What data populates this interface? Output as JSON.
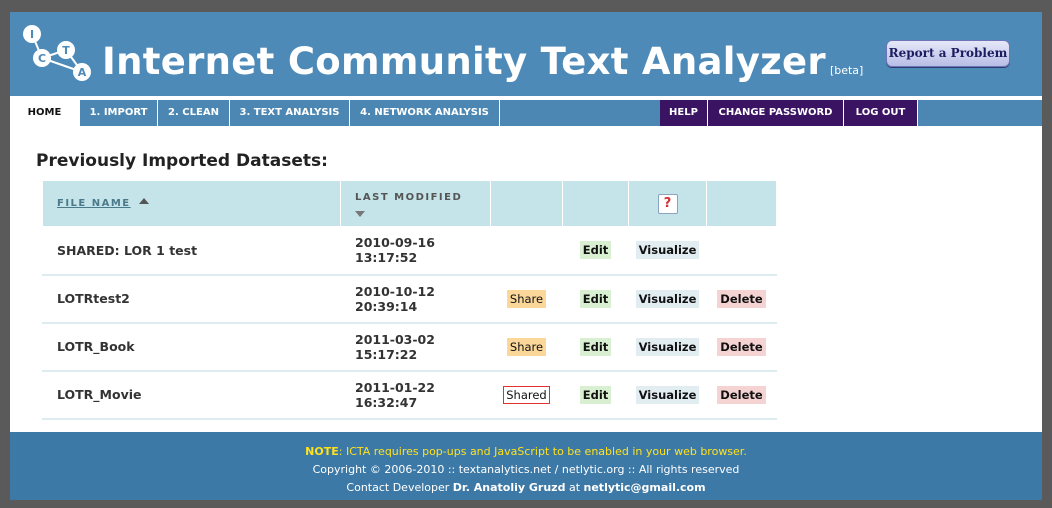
{
  "header": {
    "title": "Internet Community Text Analyzer",
    "beta": "[beta]",
    "report_button": "Report a Problem",
    "logo_letters": [
      "I",
      "C",
      "T",
      "A"
    ]
  },
  "nav": {
    "home": "HOME",
    "import": "1. IMPORT",
    "clean": "2. CLEAN",
    "text_analysis": "3. TEXT ANALYSIS",
    "network_analysis": "4. NETWORK ANALYSIS",
    "help": "HELP",
    "change_password": "CHANGE PASSWORD",
    "logout": "LOG OUT"
  },
  "main": {
    "heading": "Previously Imported Datasets:",
    "columns": {
      "file_name": "FILE NAME",
      "last_modified": "LAST MODIFIED",
      "help": "?"
    },
    "rows": [
      {
        "name": "SHARED: LOR 1 test",
        "date": "2010-09-16",
        "time": "13:17:52",
        "share": "",
        "edit": "Edit",
        "visualize": "Visualize",
        "delete": ""
      },
      {
        "name": "LOTRtest2",
        "date": "2010-10-12",
        "time": "20:39:14",
        "share": "Share",
        "edit": "Edit",
        "visualize": "Visualize",
        "delete": "Delete"
      },
      {
        "name": "LOTR_Book",
        "date": "2011-03-02",
        "time": "15:17:22",
        "share": "Share",
        "edit": "Edit",
        "visualize": "Visualize",
        "delete": "Delete"
      },
      {
        "name": "LOTR_Movie",
        "date": "2011-01-22",
        "time": "16:32:47",
        "share": "Shared",
        "edit": "Edit",
        "visualize": "Visualize",
        "delete": "Delete"
      }
    ]
  },
  "footer": {
    "note_label": "NOTE",
    "note_text": ": ICTA requires pop-ups and JavaScript to be enabled in your web browser.",
    "copyright": "Copyright © 2006-2010 :: textanalytics.net / netlytic.org :: All rights reserved",
    "contact_prefix": "Contact Developer ",
    "developer": "Dr. Anatoliy Gruzd",
    "contact_mid": " at ",
    "email": "netlytic@gmail.com"
  },
  "colors": {
    "header_bg": "#4e8ab8",
    "nav_bg": "#4c87b3",
    "nav_dark": "#3a1463",
    "table_header": "#c5e4e9",
    "footer_bg": "#3d79a6",
    "note_yellow": "#ffe21c"
  }
}
